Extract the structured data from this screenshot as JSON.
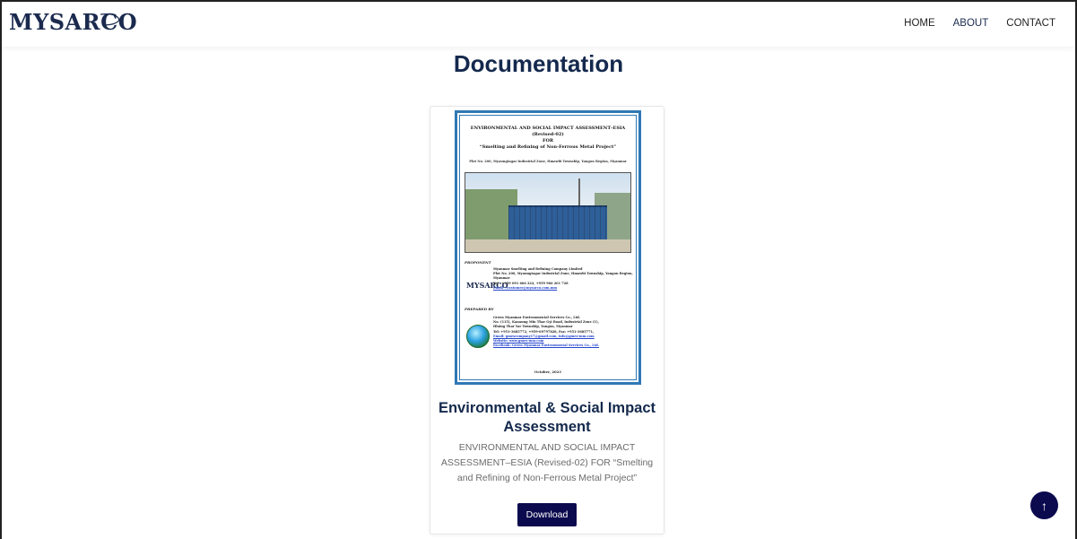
{
  "brand": {
    "logo_text": "MYSARCO"
  },
  "nav": {
    "items": [
      {
        "label": "HOME"
      },
      {
        "label": "ABOUT"
      },
      {
        "label": "CONTACT"
      }
    ]
  },
  "page": {
    "title": "Documentation"
  },
  "document_card": {
    "cover": {
      "title_line1": "ENVIRONMENTAL AND SOCIAL IMPACT ASSESSMENT–ESIA",
      "title_line2": "(Revised-02)",
      "title_line3": "FOR",
      "title_line4": "“Smelting and Refining of Non-Ferrous Metal Project”",
      "location": "Plot No. 200, Myaungtagar Industrial Zone, Hmawbi Township, Yangon Region, Myanmar",
      "proponent_label": "PROPONENT",
      "proponent_name": "Myanmar Smelting and Refining Company Limited",
      "proponent_addr": "Plot No. 200, Myaungtagar Industrial Zone, Hmawbi Township, Yangon Region, Myanmar",
      "proponent_tel": "Tel : +959 091 666 222, +959 966 201 728",
      "proponent_email": "Email : customer@mysarco.com.mm",
      "proponent_logo": "MYSARCO",
      "prepared_label": "PREPARED BY",
      "prepared_name": "Green Myanmar Environmental Services Co., Ltd.",
      "prepared_addr1": "No. (115), Kanaung Min Thar Gyi Road, Industrial Zone (1),",
      "prepared_addr2": "Hlaing Thar Yar Township, Yangon, Myanmar",
      "prepared_tel": "Tel: +951-3685772, +959-69797828, Fax: +951-3685771,",
      "prepared_email": "Email: gmescompany17@gmail.com, info@gmes-mm.com",
      "prepared_web": "Website: www.gmes-mm.com",
      "prepared_fb": "Facebook: Green Myanmar Environmental Services Co., Ltd.",
      "date": "October, 2023"
    },
    "title": "Environmental & Social Impact Assessment",
    "description": "ENVIRONMENTAL AND SOCIAL IMPACT ASSESSMENT–ESIA (Revised-02) FOR “Smelting and Refining of Non-Ferrous Metal Project”",
    "download_label": "Download"
  },
  "scroll_top": {
    "icon": "arrow-up-icon",
    "glyph": "↑"
  },
  "colors": {
    "brand_navy": "#14294d",
    "button": "#0c0a4e",
    "doc_border": "#2f78b5"
  }
}
